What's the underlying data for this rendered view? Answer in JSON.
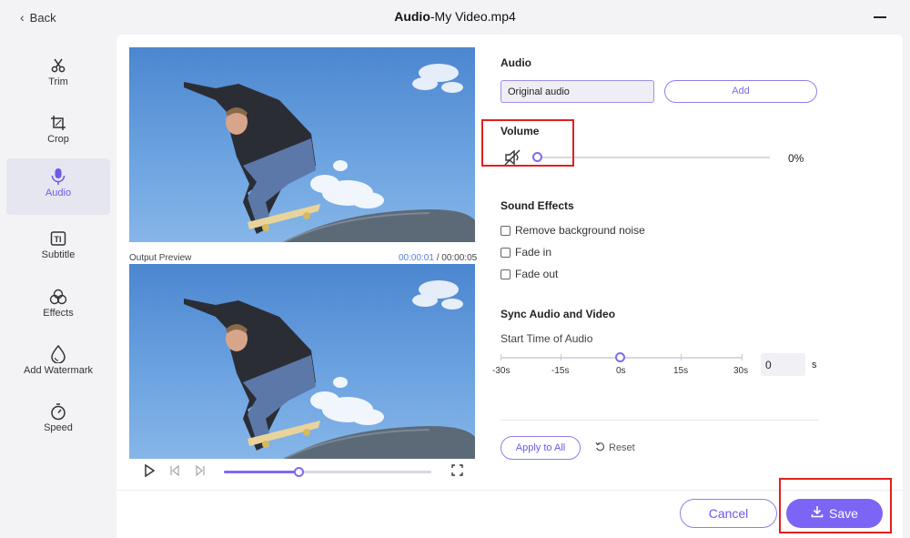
{
  "window": {
    "back_label": "Back",
    "title_bold": "Audio",
    "title_rest": "-My Video.mp4"
  },
  "sidebar": {
    "items": [
      {
        "label": "Trim",
        "icon": "scissors-icon"
      },
      {
        "label": "Crop",
        "icon": "crop-icon"
      },
      {
        "label": "Audio",
        "icon": "microphone-icon",
        "active": true
      },
      {
        "label": "Subtitle",
        "icon": "subtitle-icon"
      },
      {
        "label": "Effects",
        "icon": "effects-icon"
      },
      {
        "label": "Add Watermark",
        "icon": "watermark-icon"
      },
      {
        "label": "Speed",
        "icon": "speed-icon"
      }
    ]
  },
  "preview": {
    "label": "Output Preview",
    "current_time": "00:00:01",
    "separator": " / ",
    "total_time": "00:00:05",
    "progress": 0.36
  },
  "audio": {
    "section_title": "Audio",
    "track_name": "Original audio",
    "add_label": "Add"
  },
  "volume": {
    "section_title": "Volume",
    "value_text": "0%",
    "level": 0
  },
  "sound_effects": {
    "section_title": "Sound Effects",
    "options": [
      {
        "label": "Remove background noise",
        "checked": false
      },
      {
        "label": "Fade in",
        "checked": false
      },
      {
        "label": "Fade out",
        "checked": false
      }
    ]
  },
  "sync": {
    "section_title": "Sync Audio and Video",
    "subtitle": "Start Time of Audio",
    "ticks": [
      "-30s",
      "-15s",
      "0s",
      "15s",
      "30s"
    ],
    "value": "0",
    "unit": "s"
  },
  "actions": {
    "apply_label": "Apply to All",
    "reset_label": "Reset",
    "cancel_label": "Cancel",
    "save_label": "Save"
  },
  "colors": {
    "accent": "#7c64f4",
    "highlight_box": "#e02020"
  }
}
